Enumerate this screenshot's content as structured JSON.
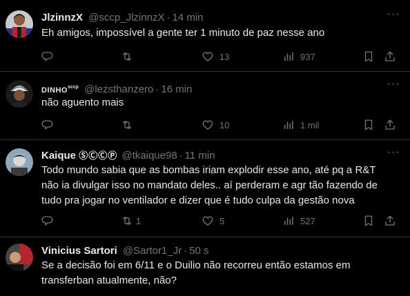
{
  "tweets": [
    {
      "name": "JlzinnzX",
      "handle": "@sccp_JlzinnzX",
      "time": "14 min",
      "text": "Eh amigos, impossível a gente ter 1 minuto de paz nesse ano",
      "retweets": "",
      "likes": "13",
      "views": "937"
    },
    {
      "name": "DINHO",
      "name_sup": "sccp",
      "handle": "@lezsthanzero",
      "time": "16 min",
      "text": "não aguento mais",
      "retweets": "",
      "likes": "10",
      "views": "1 mil"
    },
    {
      "name": "Kaique",
      "name_badge": "ⓈⒸⒸⓅ",
      "handle": "@tkaique98",
      "time": "11 min",
      "text_lines": [
        "Todo mundo sabia que as bombas iriam explodir esse ano, até pq a R&T",
        "não ia divulgar isso no mandato deles.. aí perderam e agr tão fazendo de",
        "tudo pra jogar no ventilador e dizer que é tudo culpa da gestão nova"
      ],
      "retweets": "1",
      "likes": "5",
      "views": "527"
    },
    {
      "name": "Vinicius Sartori",
      "handle": "@Sartor1_Jr",
      "time": "50 s",
      "text_lines": [
        "Se a decisão foi em 6/11 e o Duilio não recorreu então estamos em",
        "transferban atualmente, não?"
      ]
    }
  ],
  "separator": "·",
  "more_icon": "more-dots-icon"
}
